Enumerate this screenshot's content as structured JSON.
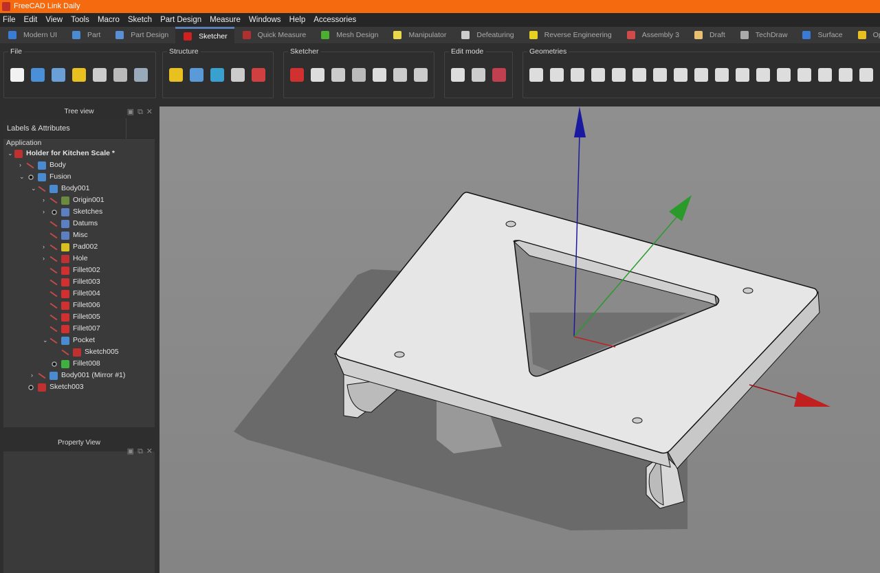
{
  "window": {
    "title": "FreeCAD Link Daily"
  },
  "menu": [
    "File",
    "Edit",
    "View",
    "Tools",
    "Macro",
    "Sketch",
    "Part Design",
    "Measure",
    "Windows",
    "Help",
    "Accessories"
  ],
  "workbenches": [
    {
      "label": "Modern UI",
      "color": "#3a7bd5"
    },
    {
      "label": "Part",
      "color": "#4a8ad0"
    },
    {
      "label": "Part Design",
      "color": "#5b8fd4"
    },
    {
      "label": "Sketcher",
      "color": "#d02020",
      "active": true
    },
    {
      "label": "Quick Measure",
      "color": "#b03030"
    },
    {
      "label": "Mesh Design",
      "color": "#4caf30"
    },
    {
      "label": "Manipulator",
      "color": "#e8d84a"
    },
    {
      "label": "Defeaturing",
      "color": "#cccccc"
    },
    {
      "label": "Reverse Engineering",
      "color": "#e8d020"
    },
    {
      "label": "Assembly 3",
      "color": "#d04a4a"
    },
    {
      "label": "Draft",
      "color": "#e8c070"
    },
    {
      "label": "TechDraw",
      "color": "#aaaaaa"
    },
    {
      "label": "Surface",
      "color": "#3a7bd5"
    },
    {
      "label": "OpenSC",
      "color": "#e8c020"
    }
  ],
  "toolbars": {
    "file": "File",
    "structure": "Structure",
    "sketcher": "Sketcher",
    "edit_mode": "Edit mode",
    "geometries": "Geometries"
  },
  "tree": {
    "title": "Tree view",
    "column": "Labels & Attributes",
    "root": "Application",
    "items": [
      {
        "label": "Holder for Kitchen Scale *",
        "level": 0,
        "exp": "v",
        "eye": "none",
        "icon": "#c03030",
        "bold": true
      },
      {
        "label": "Body",
        "level": 1,
        "exp": ">",
        "eye": "hid",
        "icon": "#4a8ad0"
      },
      {
        "label": "Fusion",
        "level": 1,
        "exp": "v",
        "eye": "vis",
        "icon": "#4a8ad0"
      },
      {
        "label": "Body001",
        "level": 2,
        "exp": "v",
        "eye": "hid",
        "icon": "#4a8ad0"
      },
      {
        "label": "Origin001",
        "level": 3,
        "exp": ">",
        "eye": "hid",
        "icon": "#6a8a40"
      },
      {
        "label": "Sketches",
        "level": 3,
        "exp": ">",
        "eye": "vis",
        "icon": "#5b7fc0"
      },
      {
        "label": "Datums",
        "level": 3,
        "exp": "",
        "eye": "hid",
        "icon": "#5b7fc0"
      },
      {
        "label": "Misc",
        "level": 3,
        "exp": "",
        "eye": "hid",
        "icon": "#5b7fc0"
      },
      {
        "label": "Pad002",
        "level": 3,
        "exp": ">",
        "eye": "hid",
        "icon": "#d8c020"
      },
      {
        "label": "Hole",
        "level": 3,
        "exp": ">",
        "eye": "hid",
        "icon": "#c03030"
      },
      {
        "label": "Fillet002",
        "level": 3,
        "exp": "",
        "eye": "hid",
        "icon": "#d03030"
      },
      {
        "label": "Fillet003",
        "level": 3,
        "exp": "",
        "eye": "hid",
        "icon": "#d03030"
      },
      {
        "label": "Fillet004",
        "level": 3,
        "exp": "",
        "eye": "hid",
        "icon": "#d03030"
      },
      {
        "label": "Fillet006",
        "level": 3,
        "exp": "",
        "eye": "hid",
        "icon": "#d03030"
      },
      {
        "label": "Fillet005",
        "level": 3,
        "exp": "",
        "eye": "hid",
        "icon": "#d03030"
      },
      {
        "label": "Fillet007",
        "level": 3,
        "exp": "",
        "eye": "hid",
        "icon": "#d03030"
      },
      {
        "label": "Pocket",
        "level": 3,
        "exp": "v",
        "eye": "hid",
        "icon": "#4a8ad0"
      },
      {
        "label": "Sketch005",
        "level": 4,
        "exp": "",
        "eye": "hid",
        "icon": "#c03030"
      },
      {
        "label": "Fillet008",
        "level": 3,
        "exp": "",
        "eye": "vis",
        "icon": "#40b040"
      },
      {
        "label": "Body001 (Mirror #1)",
        "level": 2,
        "exp": ">",
        "eye": "hid",
        "icon": "#4a8ad0"
      },
      {
        "label": "Sketch003",
        "level": 1,
        "exp": "",
        "eye": "vis",
        "icon": "#c03030"
      }
    ]
  },
  "property": {
    "title": "Property View"
  }
}
